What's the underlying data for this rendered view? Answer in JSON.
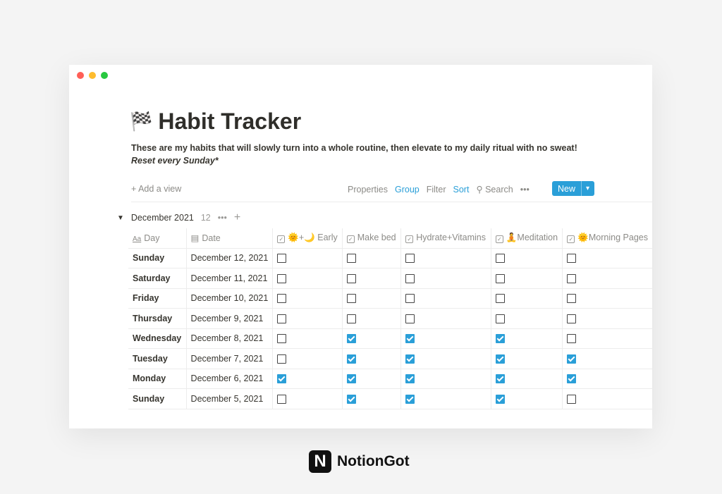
{
  "window": {
    "controls": [
      "#ff5f57",
      "#febc2e",
      "#28c840"
    ]
  },
  "page": {
    "icon": "🏁",
    "title": "Habit Tracker",
    "description": "These are my habits that will slowly turn into a whole routine, then elevate to my daily ritual with no sweat!",
    "note": "Reset every Sunday*"
  },
  "toolbar": {
    "add_view": "+ Add a view",
    "properties": "Properties",
    "group": "Group",
    "filter": "Filter",
    "sort": "Sort",
    "search": "Search",
    "more": "•••",
    "new": "New"
  },
  "group": {
    "label": "December 2021",
    "count": "12",
    "more": "•••",
    "add": "+"
  },
  "columns": [
    {
      "label": "Day",
      "icon": "Aa"
    },
    {
      "label": "Date",
      "icon": "calendar-icon"
    },
    {
      "label": "🌞+🌙 Early"
    },
    {
      "label": "Make bed"
    },
    {
      "label": "Hydrate+Vitamins"
    },
    {
      "label": "🧘Meditation"
    },
    {
      "label": "🌞Morning Pages"
    }
  ],
  "rows": [
    {
      "day": "Sunday",
      "date": "December 12, 2021",
      "checks": [
        false,
        false,
        false,
        false,
        false
      ]
    },
    {
      "day": "Saturday",
      "date": "December 11, 2021",
      "checks": [
        false,
        false,
        false,
        false,
        false
      ]
    },
    {
      "day": "Friday",
      "date": "December 10, 2021",
      "checks": [
        false,
        false,
        false,
        false,
        false
      ]
    },
    {
      "day": "Thursday",
      "date": "December 9, 2021",
      "checks": [
        false,
        false,
        false,
        false,
        false
      ]
    },
    {
      "day": "Wednesday",
      "date": "December 8, 2021",
      "checks": [
        false,
        true,
        true,
        true,
        false
      ]
    },
    {
      "day": "Tuesday",
      "date": "December 7, 2021",
      "checks": [
        false,
        true,
        true,
        true,
        true
      ]
    },
    {
      "day": "Monday",
      "date": "December 6, 2021",
      "checks": [
        true,
        true,
        true,
        true,
        true
      ]
    },
    {
      "day": "Sunday",
      "date": "December 5, 2021",
      "checks": [
        false,
        true,
        true,
        true,
        false
      ]
    }
  ],
  "brand": {
    "logo_letter": "N",
    "name": "NotionGot"
  },
  "colors": {
    "accent": "#2a9fd8"
  }
}
